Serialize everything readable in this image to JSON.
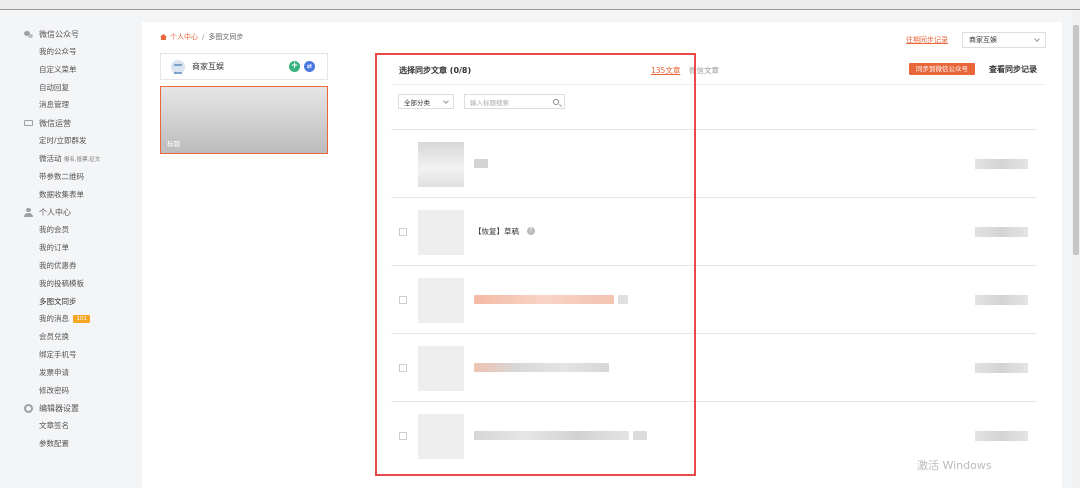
{
  "sidebar": {
    "sections": [
      {
        "title": "微信公众号",
        "icon": "chat-icon",
        "items": [
          "我的公众号",
          "自定义菜单",
          "自动回复",
          "消息管理"
        ]
      },
      {
        "title": "微信运营",
        "icon": "card-icon",
        "items": [
          "定时/立即群发",
          "微活动",
          "带参数二维码",
          "数据收集表单"
        ]
      },
      {
        "title": "个人中心",
        "icon": "user-icon",
        "items": [
          "我的会员",
          "我的订单",
          "我的优惠券",
          "我的投稿模板",
          "多图文同步",
          "我的消息",
          "会员兑换",
          "绑定手机号",
          "发票申请",
          "修改密码"
        ]
      },
      {
        "title": "编辑器设置",
        "icon": "gear-icon",
        "items": [
          "文章签名",
          "参数配置"
        ]
      }
    ],
    "micro_activity_note": "报名,投票,征文",
    "messages_badge": "101"
  },
  "breadcrumb": {
    "home": "个人中心",
    "separator": "/",
    "current": "多图文同步"
  },
  "top_right": {
    "sync_log_link": "往期同步记录",
    "account_select": "商家互娱"
  },
  "account_card": {
    "name": "商家互娱"
  },
  "preview": {
    "title": "标题"
  },
  "list_header": {
    "title": "选择同步文章 (0/8)",
    "count_link": "135文章",
    "source_label": "微信文章",
    "sync_button": "同步到微信公众号",
    "view_records": "查看同步记录"
  },
  "filter": {
    "category": "全部分类",
    "search_placeholder": "输入标题搜索"
  },
  "rows": [
    {
      "title": ""
    },
    {
      "title": "【恢复】草稿"
    },
    {
      "title": ""
    },
    {
      "title": ""
    },
    {
      "title": ""
    }
  ],
  "watermark": "激活 Windows",
  "colors": {
    "accent": "#e8663a",
    "highlight": "#e84a4a",
    "add": "#36b37e",
    "swap": "#4a78e0"
  }
}
